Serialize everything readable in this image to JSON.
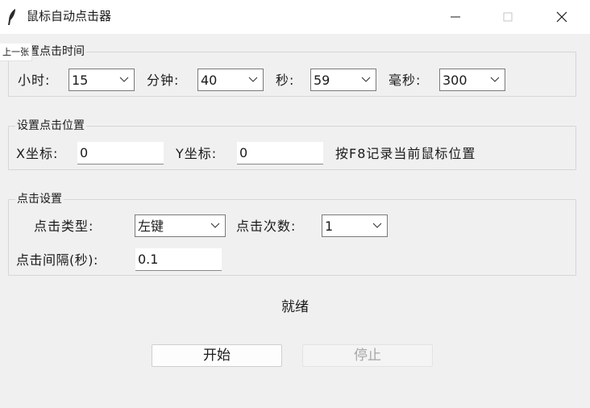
{
  "window": {
    "title": "鼠标自动点击器",
    "icon": "feather-icon"
  },
  "tooltip": "上一张",
  "time_group": {
    "title": "设置点击时间",
    "hour_label": "小时:",
    "hour_value": "15",
    "minute_label": "分钟:",
    "minute_value": "40",
    "second_label": "秒:",
    "second_value": "59",
    "ms_label": "毫秒:",
    "ms_value": "300"
  },
  "position_group": {
    "title": "设置点击位置",
    "x_label": "X坐标:",
    "x_value": "0",
    "y_label": "Y坐标:",
    "y_value": "0",
    "hint": "按F8记录当前鼠标位置"
  },
  "click_group": {
    "title": "点击设置",
    "type_label": "点击类型:",
    "type_value": "左键",
    "count_label": "点击次数:",
    "count_value": "1",
    "interval_label": "点击间隔(秒):",
    "interval_value": "0.1"
  },
  "status": "就绪",
  "buttons": {
    "start": "开始",
    "stop": "停止"
  },
  "colors": {
    "background": "#f0f0f0",
    "titlebar": "#ffffff",
    "field_border": "#7a7a7a",
    "disabled_text": "#a6a6a6"
  }
}
